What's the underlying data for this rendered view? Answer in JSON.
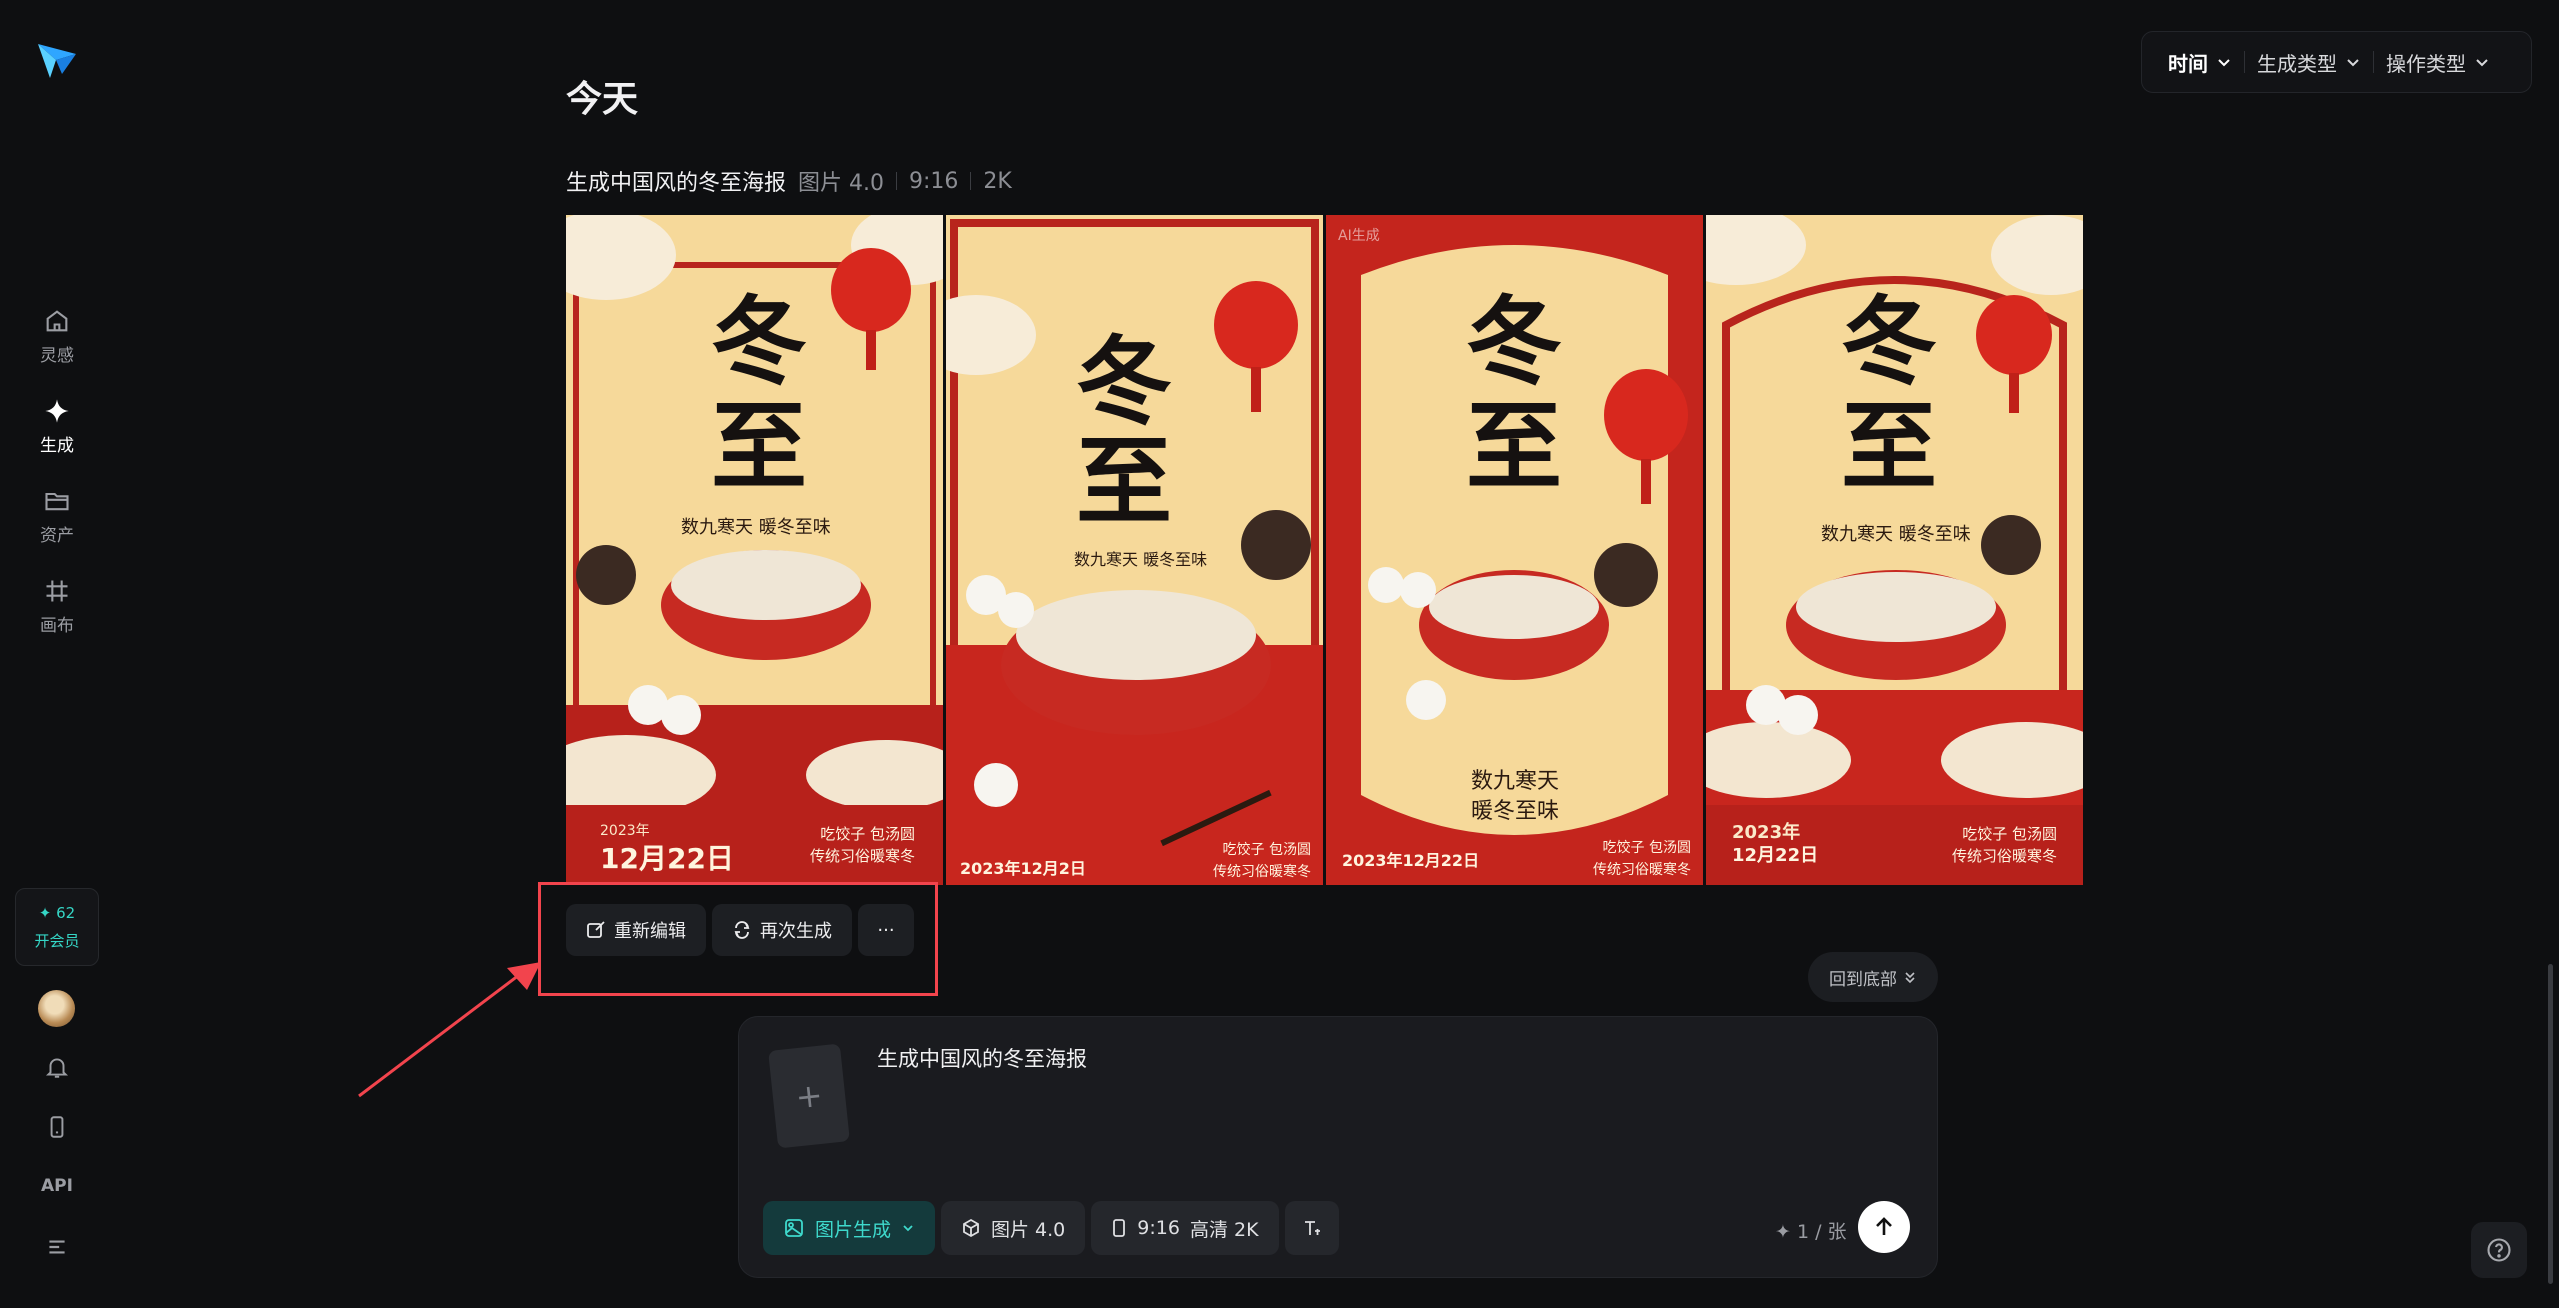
{
  "sidebar": {
    "items": [
      {
        "label": "灵感",
        "icon": "home-icon"
      },
      {
        "label": "生成",
        "icon": "sparkle-icon"
      },
      {
        "label": "资产",
        "icon": "folder-icon"
      },
      {
        "label": "画布",
        "icon": "canvas-icon"
      }
    ],
    "vip": {
      "count": "✦ 62",
      "label": "开会员"
    },
    "api_label": "API"
  },
  "filters": {
    "time": "时间",
    "gen_type": "生成类型",
    "op_type": "操作类型"
  },
  "main": {
    "day_title": "今天",
    "task": {
      "prompt": "生成中国风的冬至海报",
      "model": "图片 4.0",
      "ratio": "9:16",
      "resolution": "2K"
    }
  },
  "posters": [
    {
      "char1": "冬",
      "char2": "至",
      "subtitle": "数九寒天 暖冬至味",
      "date_small": "2023年",
      "date_big": "12月22日",
      "foot_line1": "吃饺子 包汤圆",
      "foot_line2": "传统习俗暖寒冬",
      "ai_mark": ""
    },
    {
      "char1": "冬",
      "char2": "至",
      "subtitle": "数九寒天 暖冬至味",
      "date_small": "",
      "date_big": "2023年12月2日",
      "foot_line1": "吃饺子 包汤圆",
      "foot_line2": "传统习俗暖寒冬",
      "ai_mark": ""
    },
    {
      "char1": "冬",
      "char2": "至",
      "subtitle": "数九寒天",
      "subtitle2": "暖冬至味",
      "date_small": "",
      "date_big": "2023年12月22日",
      "foot_line1": "吃饺子 包汤圆",
      "foot_line2": "传统习俗暖寒冬",
      "ai_mark": "AI生成"
    },
    {
      "char1": "冬",
      "char2": "至",
      "subtitle": "数九寒天 暖冬至味",
      "date_small": "2023年",
      "date_big": "12月22日",
      "foot_line1": "吃饺子 包汤圆",
      "foot_line2": "传统习俗暖寒冬",
      "ai_mark": ""
    }
  ],
  "actions": {
    "reedit": "重新编辑",
    "regenerate": "再次生成",
    "more": "···"
  },
  "back_to_bottom": "回到底部",
  "composer": {
    "prompt": "生成中国风的冬至海报",
    "mode": "图片生成",
    "model": "图片 4.0",
    "ratio": "9:16",
    "quality": "高清 2K",
    "credit": "✦ 1 / 张"
  },
  "colors": {
    "accent": "#35d6c6",
    "highlight": "#f2444d",
    "poster_red": "#c3241f",
    "poster_gold": "#f3cd84"
  }
}
